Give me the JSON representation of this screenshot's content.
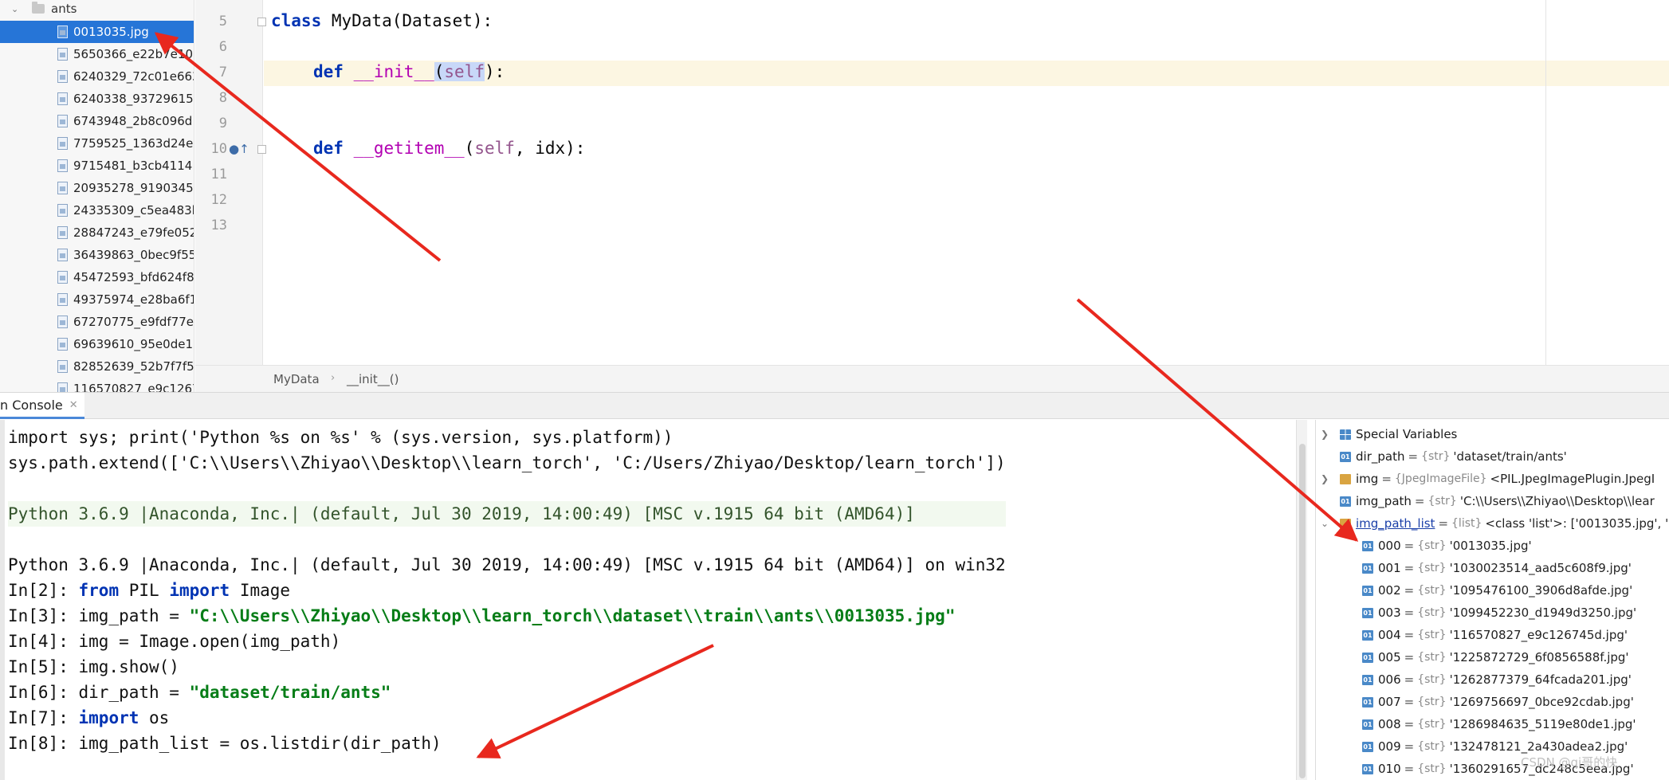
{
  "tree": {
    "folder": "ants",
    "files": [
      "0013035.jpg",
      "5650366_e22b7e10",
      "6240329_72c01e663",
      "6240338_93729615",
      "6743948_2b8c096d",
      "7759525_1363d24e",
      "9715481_b3cb4114",
      "20935278_9190345",
      "24335309_c5ea483b",
      "28847243_e79fe052",
      "36439863_0bec9f55",
      "45472593_bfd624f8",
      "49375974_e28ba6f1",
      "67270775_e9fdf77e",
      "69639610_95e0de11",
      "82852639_52b7f7f5",
      "116570827_e9c1267"
    ]
  },
  "editor": {
    "line_numbers": [
      "5",
      "6",
      "7",
      "8",
      "9",
      "10",
      "11",
      "12",
      "13"
    ],
    "code": {
      "l5_kw": "class",
      "l5_rest": " MyData(Dataset):",
      "l7_kw": "def",
      "l7_name": "__init__",
      "l7_open": "(",
      "l7_self": "self",
      "l7_close": "):",
      "l10_kw": "def",
      "l10_name": "__getitem__",
      "l10_open": "(",
      "l10_self": "self",
      "l10_rest": ", idx):"
    },
    "breadcrumb": [
      "MyData",
      "__init__()"
    ]
  },
  "console": {
    "tab_label": "n Console",
    "lines": {
      "l1": "import sys; print('Python %s on %s' % (sys.version, sys.platform))",
      "l2": "sys.path.extend(['C:\\\\Users\\\\Zhiyao\\\\Desktop\\\\learn_torch', 'C:/Users/Zhiyao/Desktop/learn_torch'])",
      "banner": "Python 3.6.9 |Anaconda, Inc.| (default, Jul 30 2019, 14:00:49) [MSC v.1915 64 bit (AMD64)]",
      "l5": "Python 3.6.9 |Anaconda, Inc.| (default, Jul 30 2019, 14:00:49) [MSC v.1915 64 bit (AMD64)] on win32",
      "in2_prompt": "In[2]: ",
      "in2_kw1": "from",
      "in2_mid": " PIL ",
      "in2_kw2": "import",
      "in2_rest": " Image",
      "in3_prompt": "In[3]: ",
      "in3_lhs": "img_path = ",
      "in3_str": "\"C:\\\\Users\\\\Zhiyao\\\\Desktop\\\\learn_torch\\\\dataset\\\\train\\\\ants\\\\0013035.jpg\"",
      "in4": "In[4]: img = Image.open(img_path)",
      "in5": "In[5]: img.show()",
      "in6_prompt": "In[6]: ",
      "in6_lhs": "dir_path = ",
      "in6_str": "\"dataset/train/ants\"",
      "in7_prompt": "In[7]: ",
      "in7_kw": "import",
      "in7_rest": " os",
      "in8": "In[8]: img_path_list = os.listdir(dir_path)"
    }
  },
  "variables": {
    "special": "Special Variables",
    "dir_path": {
      "name": "dir_path",
      "type": "{str}",
      "value": "'dataset/train/ants'"
    },
    "img": {
      "name": "img",
      "type": "{JpegImageFile}",
      "value": "<PIL.JpegImagePlugin.JpegI"
    },
    "img_path": {
      "name": "img_path",
      "type": "{str}",
      "value": "'C:\\\\Users\\\\Zhiyao\\\\Desktop\\\\lear"
    },
    "img_path_list": {
      "name": "img_path_list",
      "type": "{list}",
      "value": "<class 'list'>: ['0013035.jpg', '1"
    },
    "items": [
      {
        "idx": "000",
        "value": "'0013035.jpg'"
      },
      {
        "idx": "001",
        "value": "'1030023514_aad5c608f9.jpg'"
      },
      {
        "idx": "002",
        "value": "'1095476100_3906d8afde.jpg'"
      },
      {
        "idx": "003",
        "value": "'1099452230_d1949d3250.jpg'"
      },
      {
        "idx": "004",
        "value": "'116570827_e9c126745d.jpg'"
      },
      {
        "idx": "005",
        "value": "'1225872729_6f0856588f.jpg'"
      },
      {
        "idx": "006",
        "value": "'1262877379_64fcada201.jpg'"
      },
      {
        "idx": "007",
        "value": "'1269756697_0bce92cdab.jpg'"
      },
      {
        "idx": "008",
        "value": "'1286984635_5119e80de1.jpg'"
      },
      {
        "idx": "009",
        "value": "'132478121_2a430adea2.jpg'"
      },
      {
        "idx": "010",
        "value": "'1360291657_dc248c5eea.jpg'"
      }
    ],
    "eq": "=",
    "str_type": "{str}",
    "badge": "01"
  },
  "watermark": "CSDN @qi哥的快",
  "colors": {
    "accent": "#2675d7",
    "arrow": "#e8281e",
    "keyword": "#0033b3",
    "string": "#067d17"
  }
}
